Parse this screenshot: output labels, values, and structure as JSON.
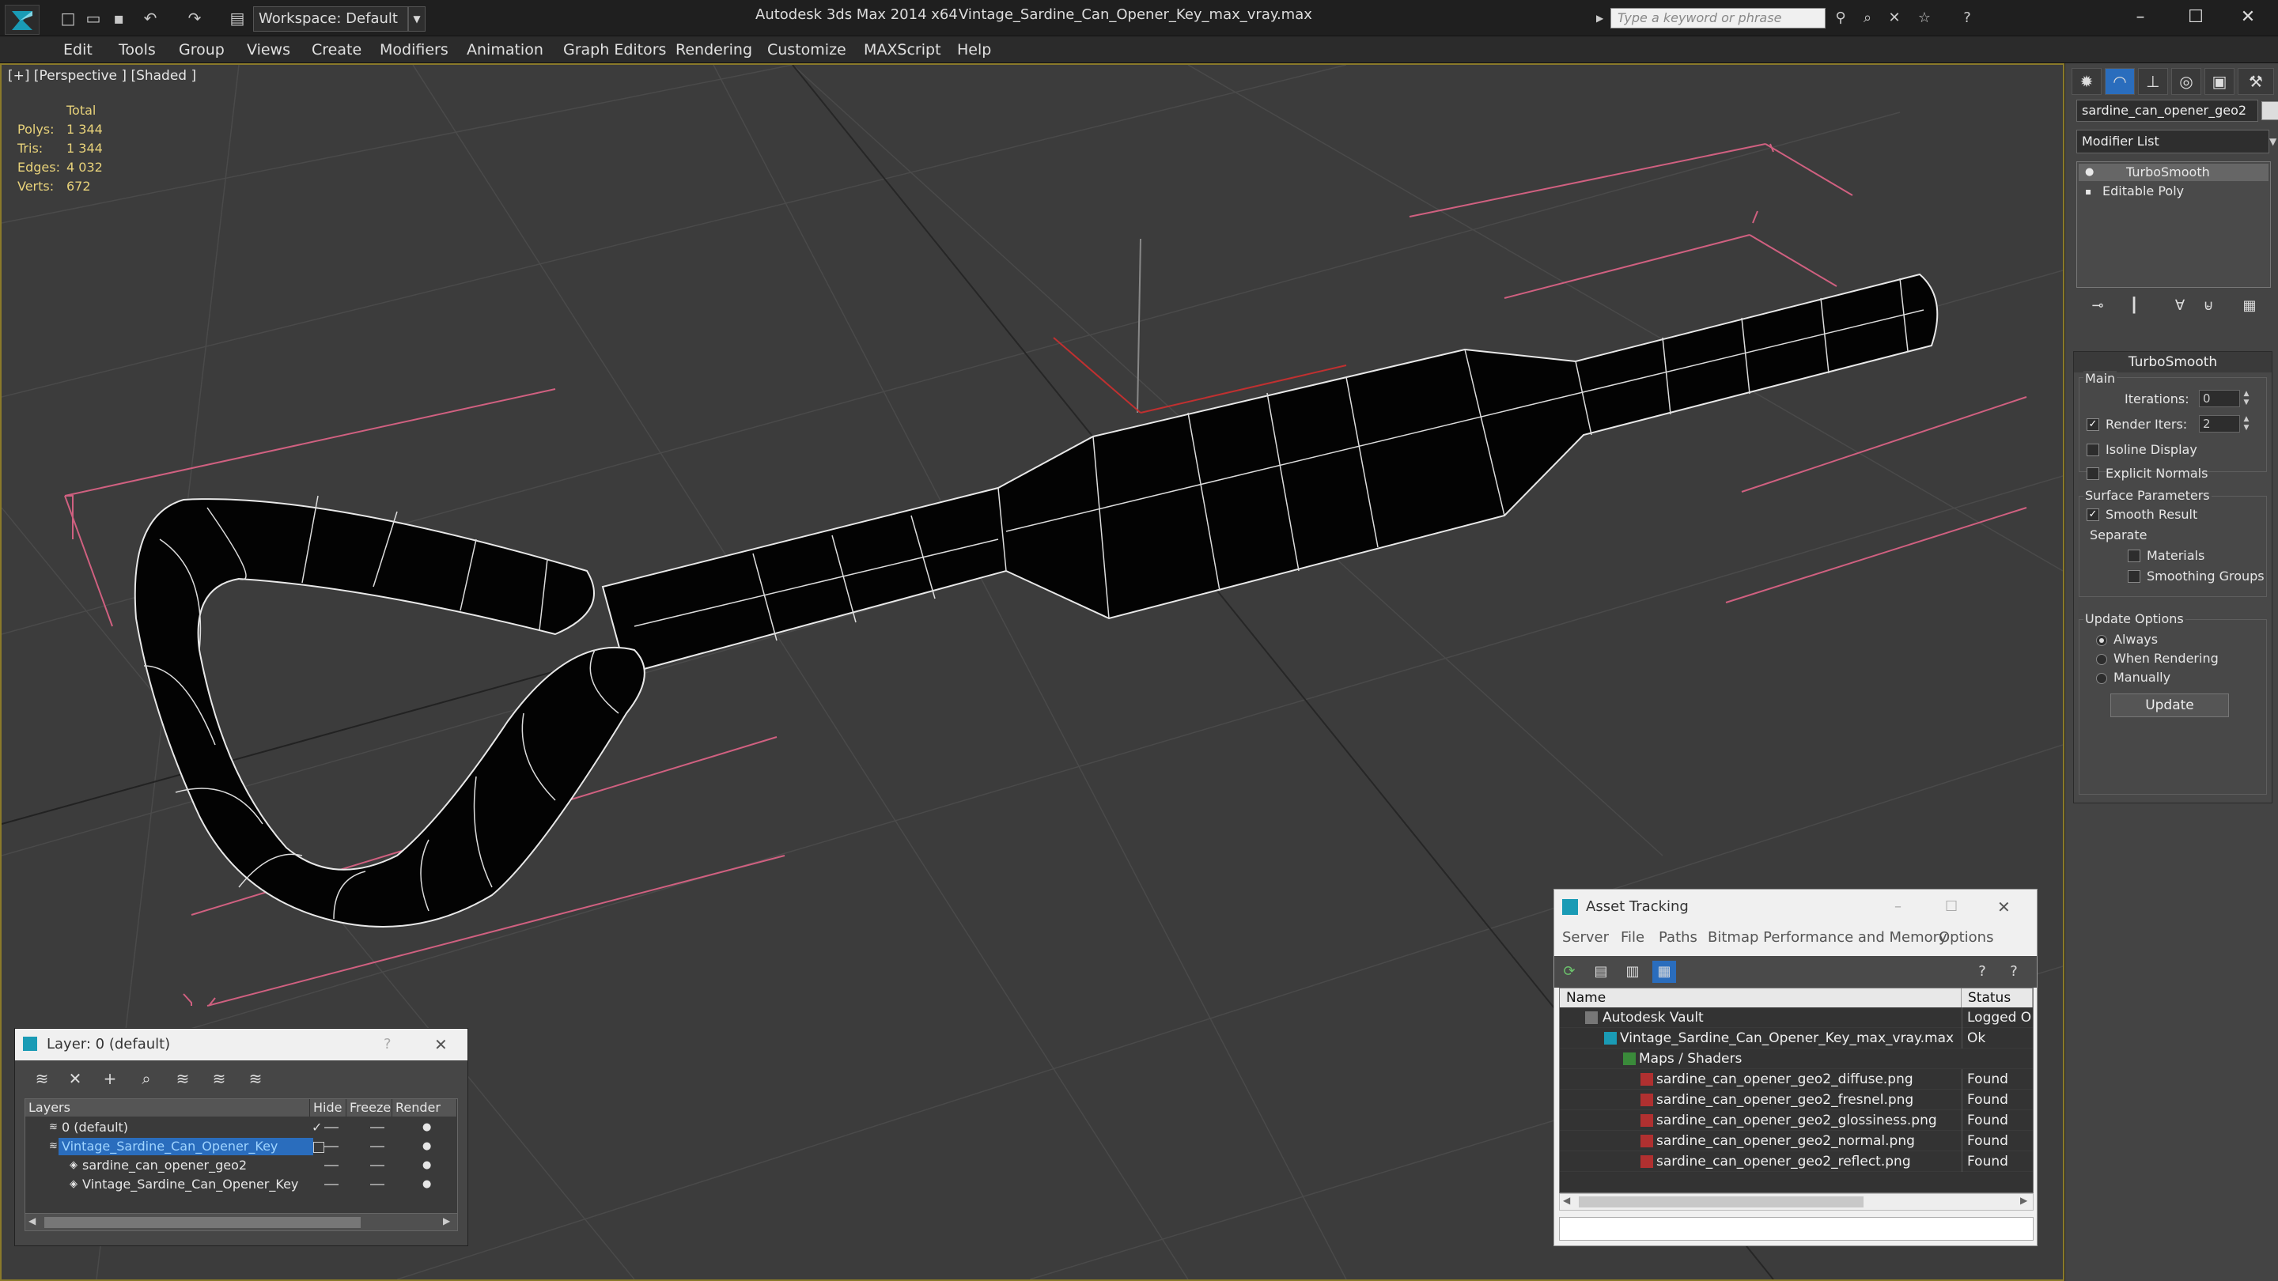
{
  "titlebar": {
    "workspace": "Workspace: Default",
    "app_title": "Autodesk 3ds Max 2014 x64",
    "file_title": "Vintage_Sardine_Can_Opener_Key_max_vray.max",
    "search_placeholder": "Type a keyword or phrase"
  },
  "menu": [
    "Edit",
    "Tools",
    "Group",
    "Views",
    "Create",
    "Modifiers",
    "Animation",
    "Graph Editors",
    "Rendering",
    "Customize",
    "MAXScript",
    "Help"
  ],
  "viewport": {
    "label": "[+] [Perspective ] [Shaded ]",
    "stats": {
      "header": "Total",
      "rows": [
        {
          "label": "Polys:",
          "value": "1 344"
        },
        {
          "label": "Tris:",
          "value": "1 344"
        },
        {
          "label": "Edges:",
          "value": "4 032"
        },
        {
          "label": "Verts:",
          "value": "672"
        }
      ]
    }
  },
  "command_panel": {
    "object_name": "sardine_can_opener_geo2",
    "modifier_list": "Modifier List",
    "stack": [
      "TurboSmooth",
      "Editable Poly"
    ],
    "rollout_title": "TurboSmooth",
    "main_label": "Main",
    "iterations_label": "Iterations:",
    "iterations_value": "0",
    "render_iters_label": "Render Iters:",
    "render_iters_value": "2",
    "isoline_label": "Isoline Display",
    "explicit_label": "Explicit Normals",
    "surface_label": "Surface Parameters",
    "smooth_label": "Smooth Result",
    "separate_label": "Separate",
    "materials_label": "Materials",
    "smoothing_groups_label": "Smoothing Groups",
    "update_options_label": "Update Options",
    "always_label": "Always",
    "when_rendering_label": "When Rendering",
    "manually_label": "Manually",
    "update_button": "Update"
  },
  "layer_dialog": {
    "title": "Layer: 0 (default)",
    "help": "?",
    "columns": [
      "Layers",
      "Hide",
      "Freeze",
      "Render"
    ],
    "rows": [
      {
        "name": "0 (default)",
        "indent": 0,
        "selected": false
      },
      {
        "name": "Vintage_Sardine_Can_Opener_Key",
        "indent": 0,
        "selected": true
      },
      {
        "name": "sardine_can_opener_geo2",
        "indent": 1,
        "selected": false
      },
      {
        "name": "Vintage_Sardine_Can_Opener_Key",
        "indent": 1,
        "selected": false
      }
    ]
  },
  "asset_tracking": {
    "title": "Asset Tracking",
    "menu": [
      "Server",
      "File",
      "Paths",
      "Bitmap Performance and Memory",
      "Options"
    ],
    "columns": [
      "Name",
      "Status"
    ],
    "rows": [
      {
        "name": "Autodesk Vault",
        "status": "Logged Out",
        "indent": 0
      },
      {
        "name": "Vintage_Sardine_Can_Opener_Key_max_vray.max",
        "status": "Ok",
        "indent": 1
      },
      {
        "name": "Maps / Shaders",
        "status": "",
        "indent": 2
      },
      {
        "name": "sardine_can_opener_geo2_diffuse.png",
        "status": "Found",
        "indent": 3
      },
      {
        "name": "sardine_can_opener_geo2_fresnel.png",
        "status": "Found",
        "indent": 3
      },
      {
        "name": "sardine_can_opener_geo2_glossiness.png",
        "status": "Found",
        "indent": 3
      },
      {
        "name": "sardine_can_opener_geo2_normal.png",
        "status": "Found",
        "indent": 3
      },
      {
        "name": "sardine_can_opener_geo2_reflect.png",
        "status": "Found",
        "indent": 3
      }
    ]
  }
}
